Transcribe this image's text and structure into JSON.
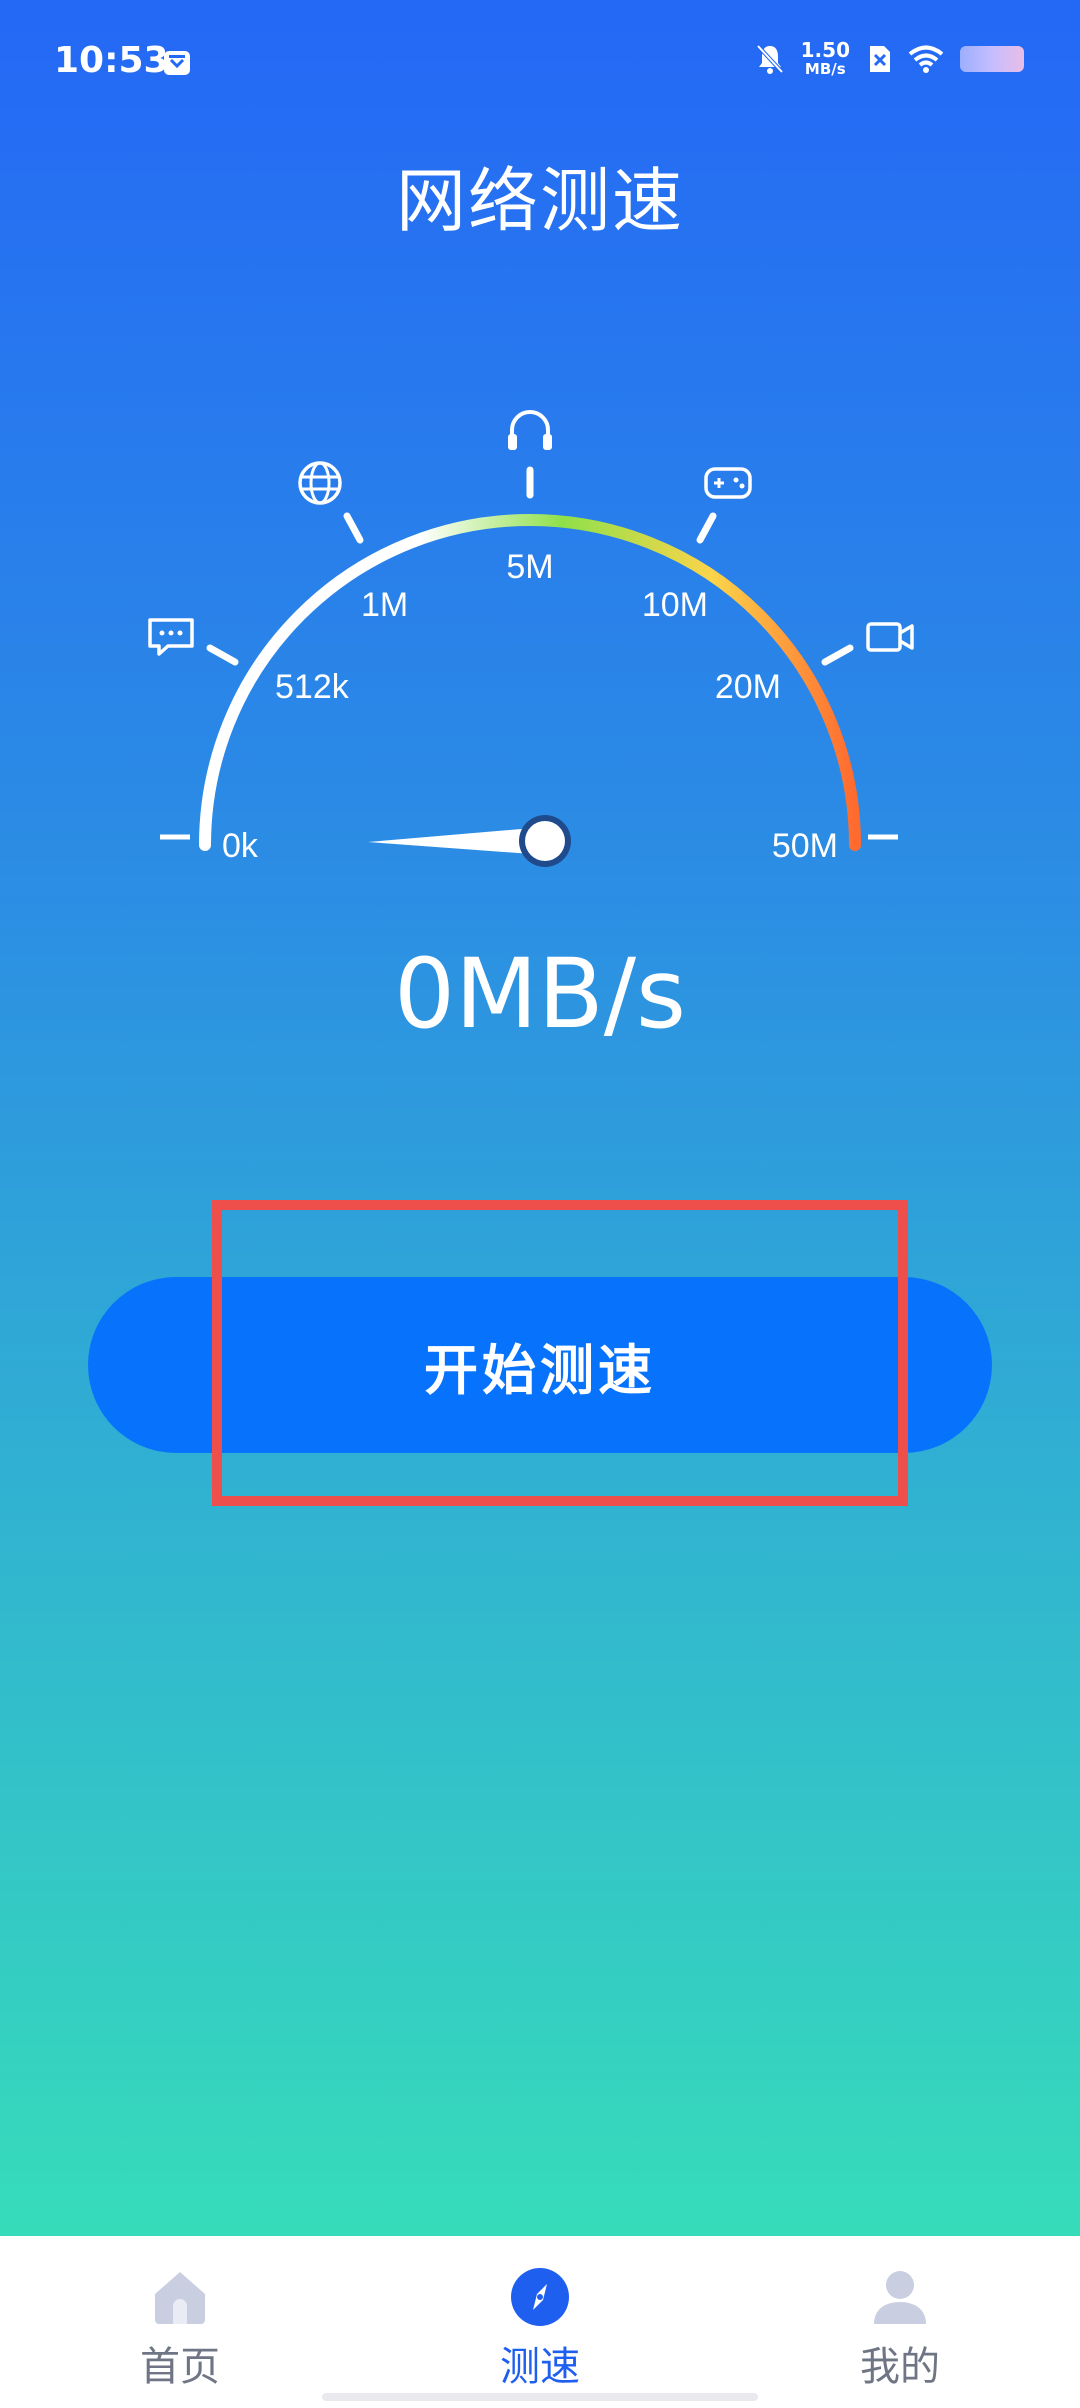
{
  "status_bar": {
    "time": "10:53",
    "net_speed_value": "1.50",
    "net_speed_unit": "MB/s"
  },
  "title": "网络测速",
  "gauge": {
    "labels": {
      "l0": "0k",
      "l512": "512k",
      "l1m": "1M",
      "l5m": "5M",
      "l10m": "10M",
      "l20m": "20M",
      "l50m": "50M"
    },
    "arc_colors": [
      "#ffffff",
      "#8fe04a",
      "#fbd44a",
      "#ff6a2f"
    ],
    "icons": [
      "message-icon",
      "globe-icon",
      "headphones-icon",
      "gamepad-icon",
      "video-camera-icon"
    ]
  },
  "speed_display": "0MB/s",
  "start_button": {
    "label": "开始测速"
  },
  "bottom_nav": {
    "items": [
      {
        "label": "首页",
        "icon": "home-icon"
      },
      {
        "label": "测速",
        "icon": "compass-icon"
      },
      {
        "label": "我的",
        "icon": "profile-icon"
      }
    ]
  },
  "colors": {
    "accent": "#0773fd",
    "active_nav": "#1f5ff0",
    "highlight": "#ef4f4a"
  }
}
